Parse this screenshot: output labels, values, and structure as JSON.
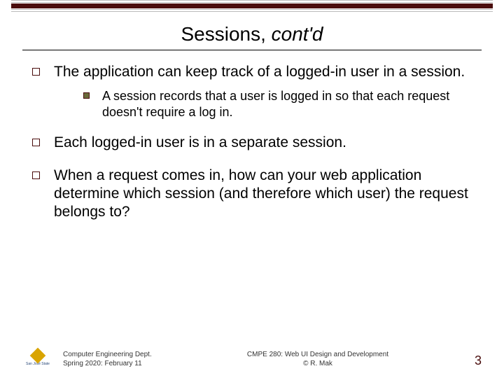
{
  "title": {
    "main": "Sessions, ",
    "italic": "cont'd"
  },
  "points": [
    {
      "text": "The application can keep track of a logged-in user in a session.",
      "sub": [
        "A session records that a user is logged in so that each request doesn't require a log in."
      ]
    },
    {
      "text": "Each logged-in user is in a separate session."
    },
    {
      "text": "When a request comes in, how can your web application determine which session (and therefore which user) the request belongs to?"
    }
  ],
  "footer": {
    "left_line1": "Computer Engineering Dept.",
    "left_line2": "Spring 2020: February 11",
    "center_line1": "CMPE 280: Web UI Design and Development",
    "center_line2": "© R. Mak",
    "page": "3",
    "logo_text": "San José State"
  }
}
